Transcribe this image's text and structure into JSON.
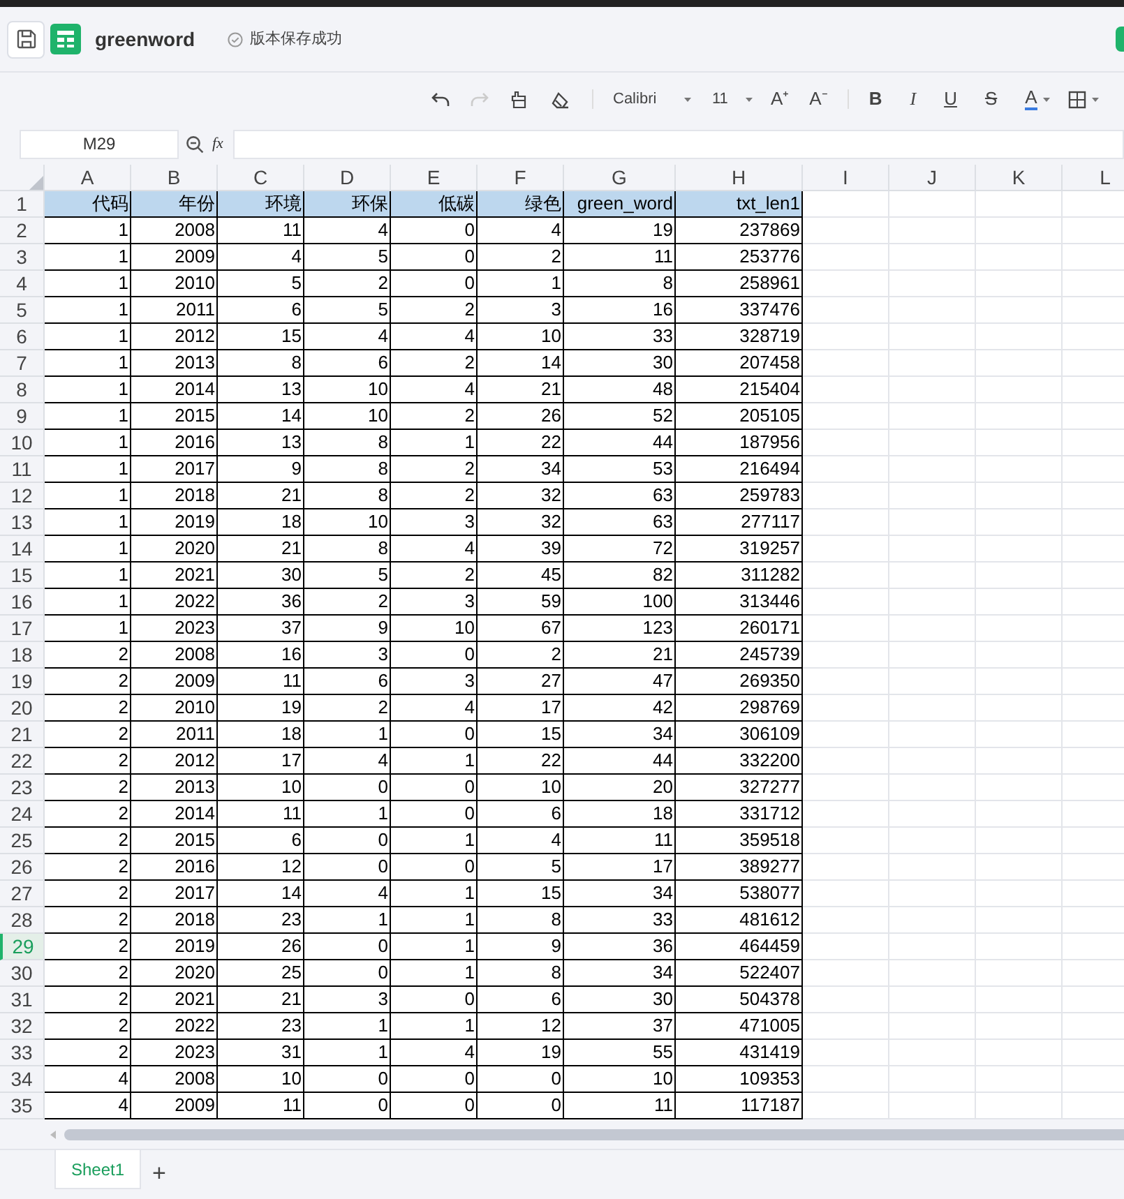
{
  "header": {
    "title": "greenword",
    "save_status": "版本保存成功"
  },
  "toolbar": {
    "undo": {
      "disabled": false
    },
    "redo": {
      "disabled": true
    },
    "font": "Calibri",
    "font_size": "11",
    "grow_font": "A⁺",
    "shrink_font": "A⁻",
    "bold": "B",
    "italic": "I",
    "underline": "U",
    "strikethrough": "S",
    "font_color": "A"
  },
  "formula_bar": {
    "name_box": "M29",
    "fx": "fx"
  },
  "sheet": {
    "columns": [
      "A",
      "B",
      "C",
      "D",
      "E",
      "F",
      "G",
      "H",
      "I",
      "J",
      "K",
      "L"
    ],
    "rows": [
      {
        "n": "1",
        "selected": false,
        "header": true,
        "cells": [
          "代码",
          "年份",
          "环境",
          "环保",
          "低碳",
          "绿色",
          "green_word",
          "txt_len1"
        ]
      },
      {
        "n": "2",
        "selected": false,
        "header": false,
        "cells": [
          "1",
          "2008",
          "11",
          "4",
          "0",
          "4",
          "19",
          "237869"
        ]
      },
      {
        "n": "3",
        "selected": false,
        "header": false,
        "cells": [
          "1",
          "2009",
          "4",
          "5",
          "0",
          "2",
          "11",
          "253776"
        ]
      },
      {
        "n": "4",
        "selected": false,
        "header": false,
        "cells": [
          "1",
          "2010",
          "5",
          "2",
          "0",
          "1",
          "8",
          "258961"
        ]
      },
      {
        "n": "5",
        "selected": false,
        "header": false,
        "cells": [
          "1",
          "2011",
          "6",
          "5",
          "2",
          "3",
          "16",
          "337476"
        ]
      },
      {
        "n": "6",
        "selected": false,
        "header": false,
        "cells": [
          "1",
          "2012",
          "15",
          "4",
          "4",
          "10",
          "33",
          "328719"
        ]
      },
      {
        "n": "7",
        "selected": false,
        "header": false,
        "cells": [
          "1",
          "2013",
          "8",
          "6",
          "2",
          "14",
          "30",
          "207458"
        ]
      },
      {
        "n": "8",
        "selected": false,
        "header": false,
        "cells": [
          "1",
          "2014",
          "13",
          "10",
          "4",
          "21",
          "48",
          "215404"
        ]
      },
      {
        "n": "9",
        "selected": false,
        "header": false,
        "cells": [
          "1",
          "2015",
          "14",
          "10",
          "2",
          "26",
          "52",
          "205105"
        ]
      },
      {
        "n": "10",
        "selected": false,
        "header": false,
        "cells": [
          "1",
          "2016",
          "13",
          "8",
          "1",
          "22",
          "44",
          "187956"
        ]
      },
      {
        "n": "11",
        "selected": false,
        "header": false,
        "cells": [
          "1",
          "2017",
          "9",
          "8",
          "2",
          "34",
          "53",
          "216494"
        ]
      },
      {
        "n": "12",
        "selected": false,
        "header": false,
        "cells": [
          "1",
          "2018",
          "21",
          "8",
          "2",
          "32",
          "63",
          "259783"
        ]
      },
      {
        "n": "13",
        "selected": false,
        "header": false,
        "cells": [
          "1",
          "2019",
          "18",
          "10",
          "3",
          "32",
          "63",
          "277117"
        ]
      },
      {
        "n": "14",
        "selected": false,
        "header": false,
        "cells": [
          "1",
          "2020",
          "21",
          "8",
          "4",
          "39",
          "72",
          "319257"
        ]
      },
      {
        "n": "15",
        "selected": false,
        "header": false,
        "cells": [
          "1",
          "2021",
          "30",
          "5",
          "2",
          "45",
          "82",
          "311282"
        ]
      },
      {
        "n": "16",
        "selected": false,
        "header": false,
        "cells": [
          "1",
          "2022",
          "36",
          "2",
          "3",
          "59",
          "100",
          "313446"
        ]
      },
      {
        "n": "17",
        "selected": false,
        "header": false,
        "cells": [
          "1",
          "2023",
          "37",
          "9",
          "10",
          "67",
          "123",
          "260171"
        ]
      },
      {
        "n": "18",
        "selected": false,
        "header": false,
        "cells": [
          "2",
          "2008",
          "16",
          "3",
          "0",
          "2",
          "21",
          "245739"
        ]
      },
      {
        "n": "19",
        "selected": false,
        "header": false,
        "cells": [
          "2",
          "2009",
          "11",
          "6",
          "3",
          "27",
          "47",
          "269350"
        ]
      },
      {
        "n": "20",
        "selected": false,
        "header": false,
        "cells": [
          "2",
          "2010",
          "19",
          "2",
          "4",
          "17",
          "42",
          "298769"
        ]
      },
      {
        "n": "21",
        "selected": false,
        "header": false,
        "cells": [
          "2",
          "2011",
          "18",
          "1",
          "0",
          "15",
          "34",
          "306109"
        ]
      },
      {
        "n": "22",
        "selected": false,
        "header": false,
        "cells": [
          "2",
          "2012",
          "17",
          "4",
          "1",
          "22",
          "44",
          "332200"
        ]
      },
      {
        "n": "23",
        "selected": false,
        "header": false,
        "cells": [
          "2",
          "2013",
          "10",
          "0",
          "0",
          "10",
          "20",
          "327277"
        ]
      },
      {
        "n": "24",
        "selected": false,
        "header": false,
        "cells": [
          "2",
          "2014",
          "11",
          "1",
          "0",
          "6",
          "18",
          "331712"
        ]
      },
      {
        "n": "25",
        "selected": false,
        "header": false,
        "cells": [
          "2",
          "2015",
          "6",
          "0",
          "1",
          "4",
          "11",
          "359518"
        ]
      },
      {
        "n": "26",
        "selected": false,
        "header": false,
        "cells": [
          "2",
          "2016",
          "12",
          "0",
          "0",
          "5",
          "17",
          "389277"
        ]
      },
      {
        "n": "27",
        "selected": false,
        "header": false,
        "cells": [
          "2",
          "2017",
          "14",
          "4",
          "1",
          "15",
          "34",
          "538077"
        ]
      },
      {
        "n": "28",
        "selected": false,
        "header": false,
        "cells": [
          "2",
          "2018",
          "23",
          "1",
          "1",
          "8",
          "33",
          "481612"
        ]
      },
      {
        "n": "29",
        "selected": true,
        "header": false,
        "cells": [
          "2",
          "2019",
          "26",
          "0",
          "1",
          "9",
          "36",
          "464459"
        ]
      },
      {
        "n": "30",
        "selected": false,
        "header": false,
        "cells": [
          "2",
          "2020",
          "25",
          "0",
          "1",
          "8",
          "34",
          "522407"
        ]
      },
      {
        "n": "31",
        "selected": false,
        "header": false,
        "cells": [
          "2",
          "2021",
          "21",
          "3",
          "0",
          "6",
          "30",
          "504378"
        ]
      },
      {
        "n": "32",
        "selected": false,
        "header": false,
        "cells": [
          "2",
          "2022",
          "23",
          "1",
          "1",
          "12",
          "37",
          "471005"
        ]
      },
      {
        "n": "33",
        "selected": false,
        "header": false,
        "cells": [
          "2",
          "2023",
          "31",
          "1",
          "4",
          "19",
          "55",
          "431419"
        ]
      },
      {
        "n": "34",
        "selected": false,
        "header": false,
        "cells": [
          "4",
          "2008",
          "10",
          "0",
          "0",
          "0",
          "10",
          "109353"
        ]
      },
      {
        "n": "35",
        "selected": false,
        "header": false,
        "cells": [
          "4",
          "2009",
          "11",
          "0",
          "0",
          "0",
          "11",
          "117187"
        ]
      }
    ]
  },
  "sheet_tabs": [
    {
      "label": "Sheet1",
      "selected": true
    }
  ],
  "add_sheet": "+"
}
